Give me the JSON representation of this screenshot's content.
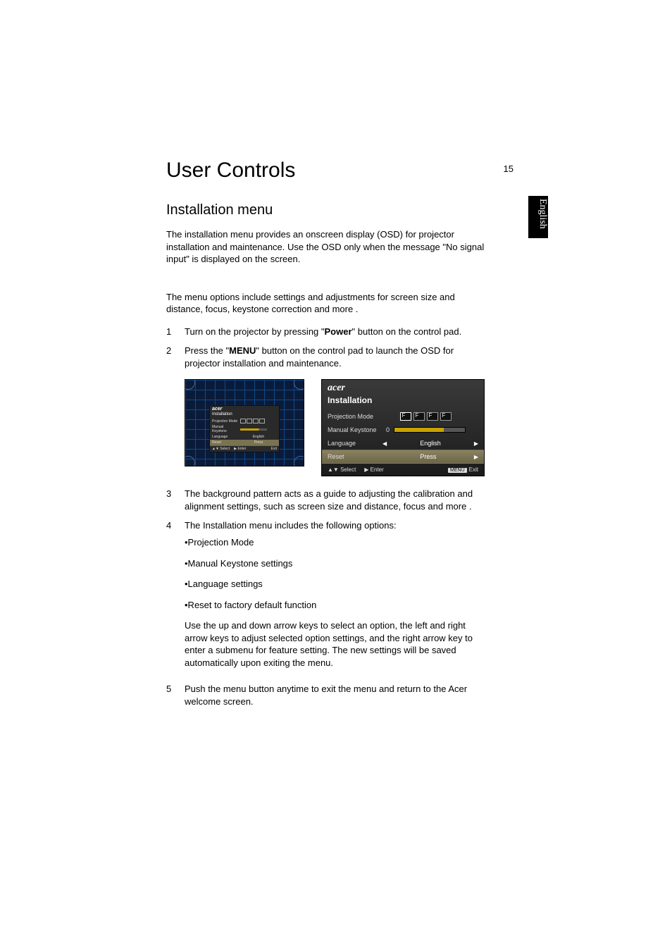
{
  "page_number": "15",
  "side_tab": "English",
  "h1": "User Controls",
  "h2": "Installation menu",
  "p1": "The installation menu provides an onscreen display (OSD) for projector installation and maintenance. Use the OSD only when the message \"No signal input\" is displayed on the screen.",
  "p2": "The menu options include settings and adjustments for screen size and distance, focus, keystone correction and more .",
  "steps12": [
    {
      "n": "1",
      "t_pre": "Turn on the projector by pressing \"",
      "t_bold": "Power",
      "t_post": "\" button on the control pad."
    },
    {
      "n": "2",
      "t_pre": "Press the \"",
      "t_bold": "MENU",
      "t_post": "\" button on the control pad to launch the OSD for projector installation and maintenance."
    }
  ],
  "osd": {
    "brand": "acer",
    "title": "Installation",
    "row_proj": "Projection Mode",
    "row_key": "Manual Keystone",
    "key_val": "0",
    "row_lang": "Language",
    "lang_val": "English",
    "row_reset": "Reset",
    "reset_val": "Press",
    "footer_select": "Select",
    "footer_enter": "Enter",
    "footer_menu": "MENU",
    "footer_exit": "Exit"
  },
  "steps345": [
    {
      "n": "3",
      "t": "The background pattern acts as a guide to adjusting the calibration and alignment settings, such as screen size and distance, focus and more ."
    },
    {
      "n": "4",
      "t": "The Installation menu includes the following options:"
    }
  ],
  "bullets": [
    "•Projection Mode",
    "•Manual Keystone settings",
    "•Language settings",
    "•Reset to factory default function"
  ],
  "sub_p": "Use the up and down arrow keys to select an option, the left and right arrow keys to adjust selected option settings, and the right arrow key to enter a submenu for feature setting. The new settings will be saved automatically upon exiting the menu.",
  "step5": {
    "n": "5",
    "t": "Push the menu button anytime to exit the menu and return to the Acer welcome screen."
  }
}
